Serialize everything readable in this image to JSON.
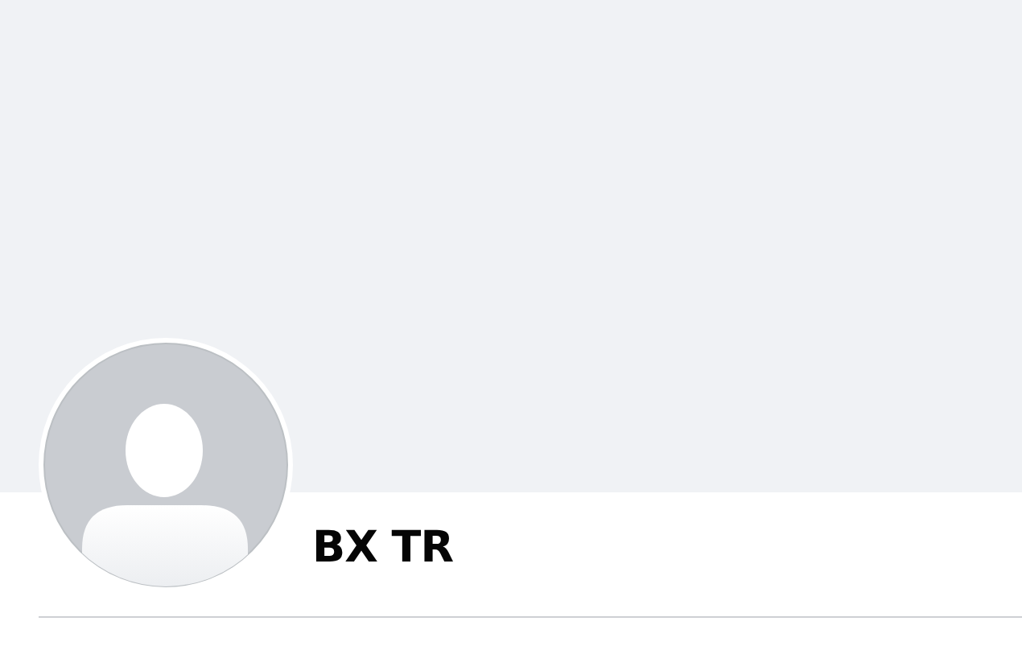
{
  "profile": {
    "name": "BX TR"
  }
}
